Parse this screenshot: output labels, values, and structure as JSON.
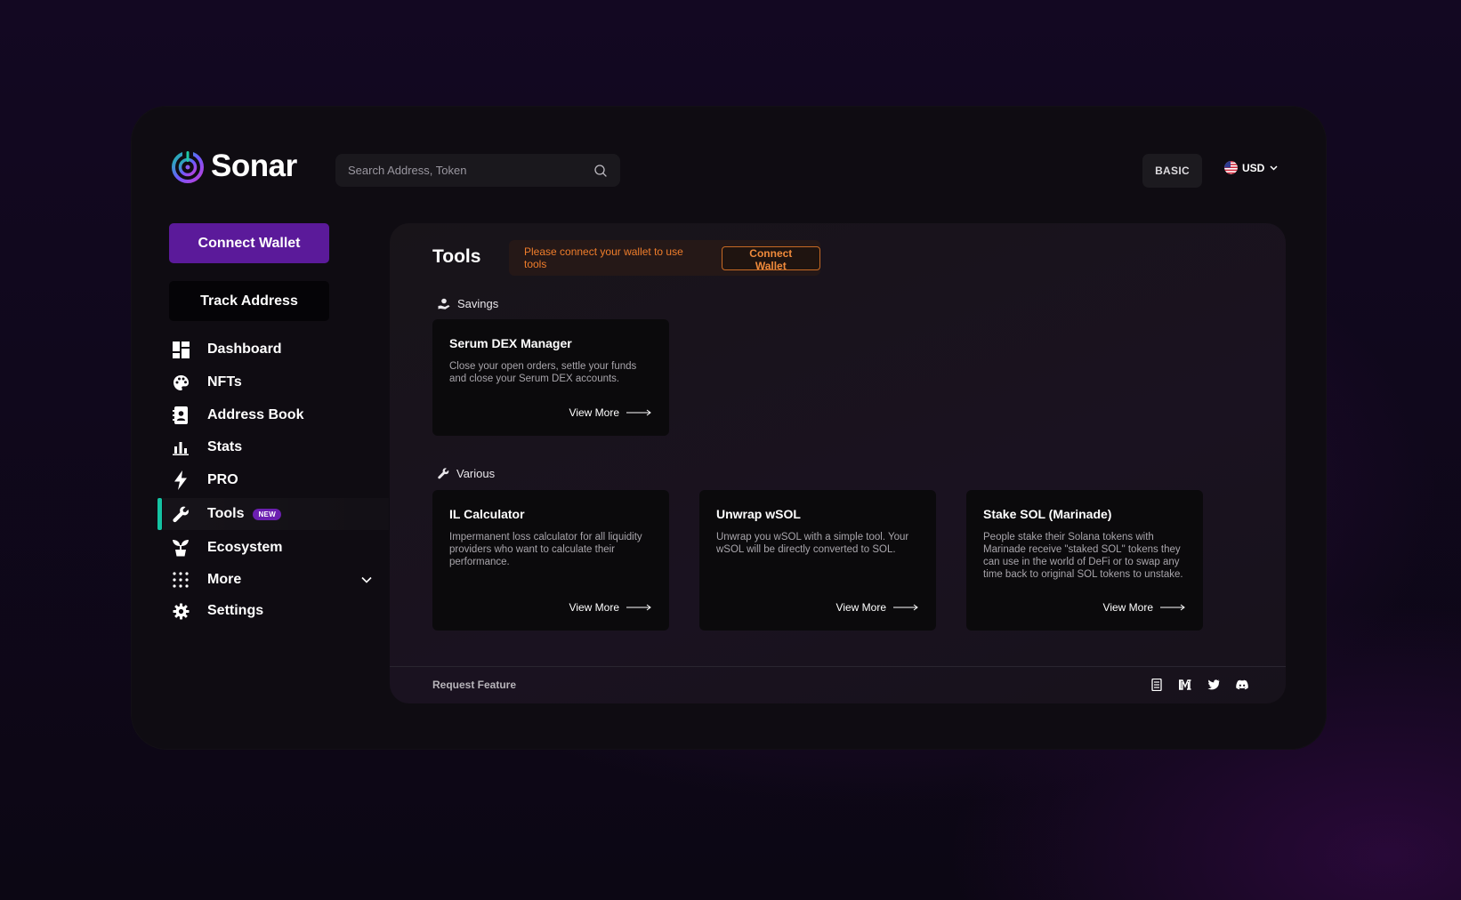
{
  "brand": {
    "name": "Sonar"
  },
  "search": {
    "placeholder": "Search Address, Token"
  },
  "header": {
    "plan_label": "BASIC",
    "currency": "USD"
  },
  "sidebar": {
    "connect_wallet": "Connect Wallet",
    "track_address": "Track Address",
    "items": [
      {
        "label": "Dashboard",
        "icon": "dashboard-icon"
      },
      {
        "label": "NFTs",
        "icon": "palette-icon"
      },
      {
        "label": "Address Book",
        "icon": "address-book-icon"
      },
      {
        "label": "Stats",
        "icon": "bar-chart-icon"
      },
      {
        "label": "PRO",
        "icon": "lightning-icon"
      },
      {
        "label": "Tools",
        "icon": "wrench-icon",
        "badge": "NEW",
        "active": true
      },
      {
        "label": "Ecosystem",
        "icon": "sprout-icon"
      },
      {
        "label": "More",
        "icon": "grid-dots-icon"
      },
      {
        "label": "Settings",
        "icon": "gear-icon"
      }
    ]
  },
  "main": {
    "title": "Tools",
    "warning": {
      "text": "Please connect your wallet to use tools",
      "button": "Connect Wallet"
    },
    "sections": [
      {
        "label": "Savings",
        "cards": [
          {
            "title": "Serum DEX Manager",
            "desc": "Close your open orders, settle your funds and close your Serum DEX accounts.",
            "link": "View More"
          }
        ]
      },
      {
        "label": "Various",
        "cards": [
          {
            "title": "IL Calculator",
            "desc": "Impermanent loss calculator for all liquidity providers who want to calculate their performance.",
            "link": "View More"
          },
          {
            "title": "Unwrap wSOL",
            "desc": "Unwrap you wSOL with a simple tool. Your wSOL will be directly converted to SOL.",
            "link": "View More"
          },
          {
            "title": "Stake SOL (Marinade)",
            "desc": "People stake their Solana tokens with Marinade receive \"staked SOL\" tokens they can use in the world of DeFi or to swap any time back to original SOL tokens to unstake.",
            "link": "View More"
          }
        ]
      }
    ]
  },
  "footer": {
    "request_feature": "Request Feature"
  },
  "colors": {
    "accent_purple": "#5b1a9a",
    "active_indicator": "#14c3a2",
    "warning_orange": "#ef7d2b"
  }
}
